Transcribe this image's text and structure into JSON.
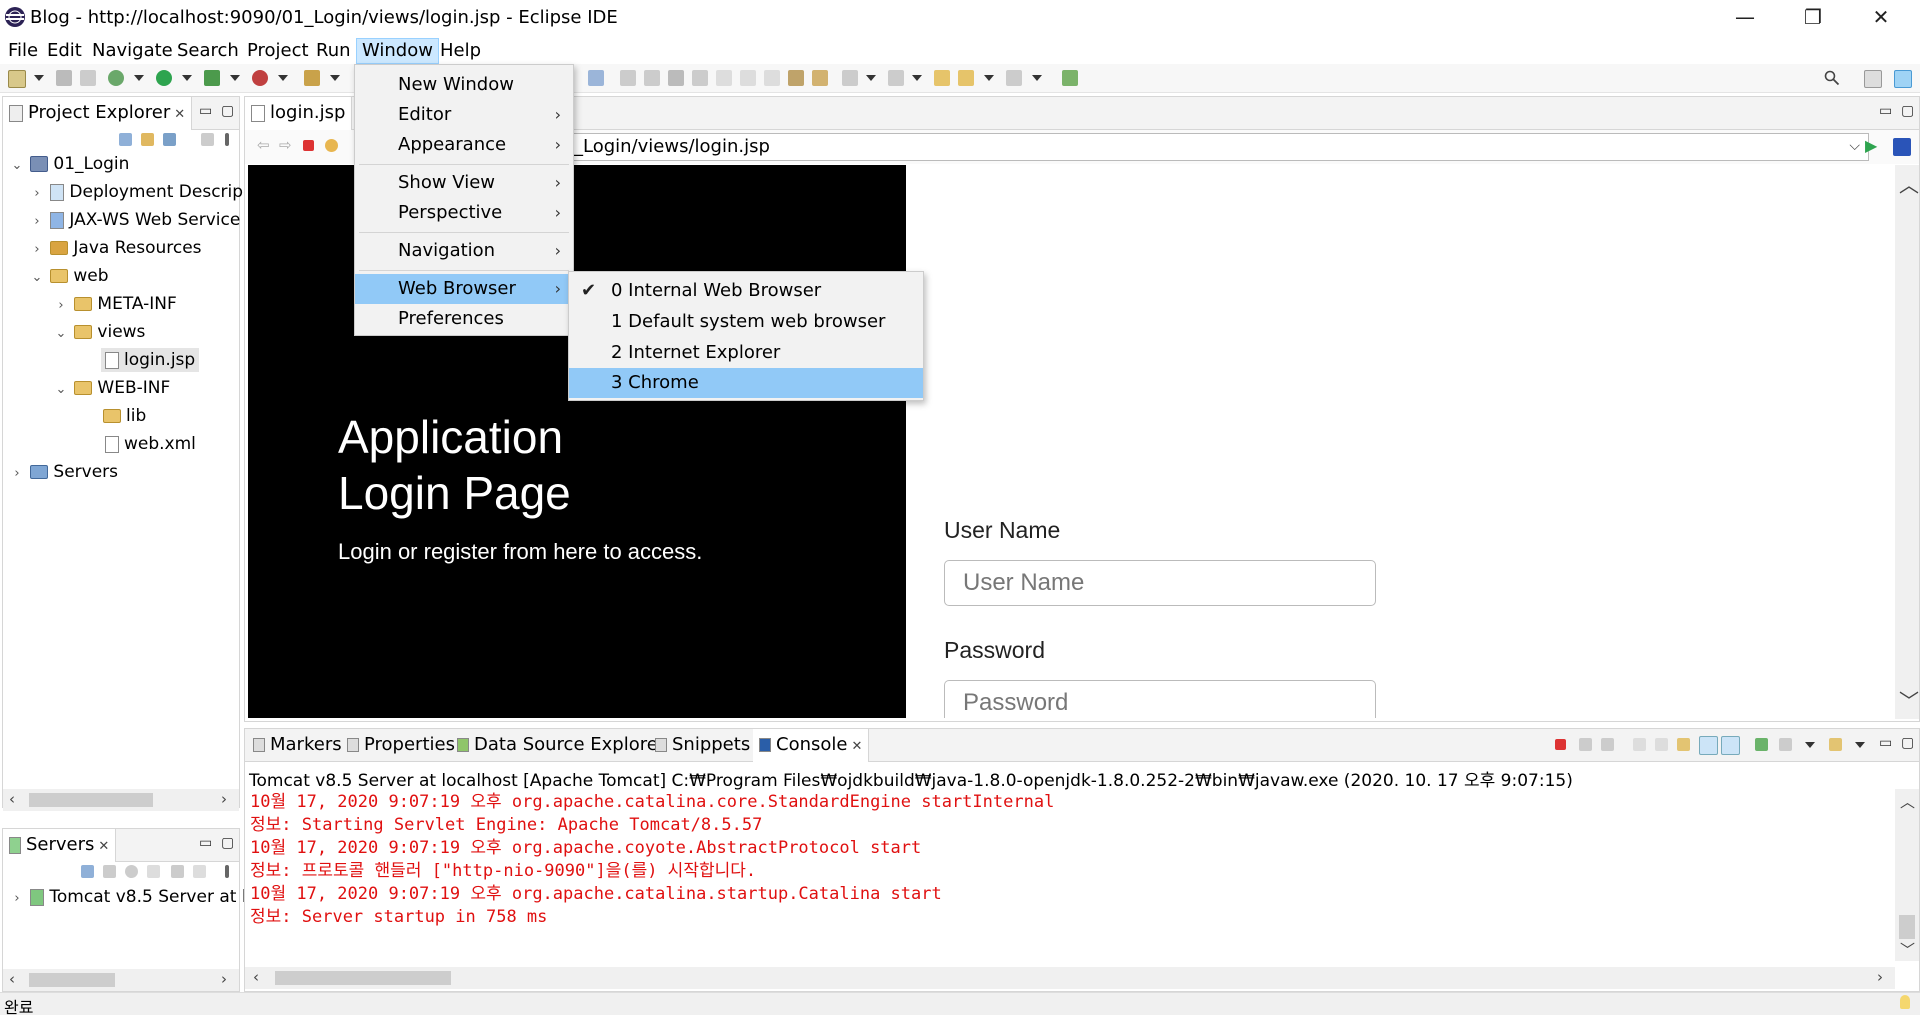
{
  "window": {
    "title": "Blog - http://localhost:9090/01_Login/views/login.jsp - Eclipse IDE",
    "minimize": "—",
    "restore": "❐",
    "close": "✕"
  },
  "menubar": {
    "items": [
      "File",
      "Edit",
      "Navigate",
      "Search",
      "Project",
      "Run",
      "Window",
      "Help"
    ]
  },
  "window_menu": {
    "items": [
      {
        "label": "New Window",
        "submenu": false
      },
      {
        "label": "Editor",
        "submenu": true
      },
      {
        "label": "Appearance",
        "submenu": true
      },
      {
        "label": "Show View",
        "submenu": true
      },
      {
        "label": "Perspective",
        "submenu": true
      },
      {
        "label": "Navigation",
        "submenu": true
      },
      {
        "label": "Web Browser",
        "submenu": true
      },
      {
        "label": "Preferences",
        "submenu": false
      }
    ],
    "submenu_arrow": "›"
  },
  "web_browser_submenu": {
    "check": "✔",
    "items": [
      "0 Internal Web Browser",
      "1 Default system web browser",
      "2 Internet Explorer",
      "3 Chrome"
    ]
  },
  "project_explorer": {
    "tab_label": "Project Explorer",
    "tree": [
      {
        "label": "01_Login",
        "twisty": "⌄",
        "icon": "project-icon"
      },
      {
        "label": "Deployment Descrip",
        "twisty": "›",
        "icon": "deployment-descriptor-icon"
      },
      {
        "label": "JAX-WS Web Service",
        "twisty": "›",
        "icon": "web-service-icon"
      },
      {
        "label": "Java Resources",
        "twisty": "›",
        "icon": "java-resources-icon"
      },
      {
        "label": "web",
        "twisty": "⌄",
        "icon": "folder-icon"
      },
      {
        "label": "META-INF",
        "twisty": "›",
        "icon": "folder-icon"
      },
      {
        "label": "views",
        "twisty": "⌄",
        "icon": "folder-icon"
      },
      {
        "label": "login.jsp",
        "twisty": "",
        "icon": "jsp-file-icon"
      },
      {
        "label": "WEB-INF",
        "twisty": "⌄",
        "icon": "folder-icon"
      },
      {
        "label": "lib",
        "twisty": "",
        "icon": "folder-icon"
      },
      {
        "label": "web.xml",
        "twisty": "",
        "icon": "xml-file-icon"
      },
      {
        "label": "Servers",
        "twisty": "›",
        "icon": "folder-icon"
      }
    ]
  },
  "servers_view": {
    "tab_label": "Servers",
    "row": "Tomcat v8.5 Server at l"
  },
  "editor": {
    "tab_label": "login.jsp",
    "url": "_Login/views/login.jsp"
  },
  "login_page": {
    "heading_line1": "Application",
    "heading_line2": "Login Page",
    "subtitle": "Login or register from here to access.",
    "username_label": "User Name",
    "username_placeholder": "User Name",
    "password_label": "Password",
    "password_placeholder": "Password"
  },
  "bottom_tabs": [
    "Markers",
    "Properties",
    "Data Source Explorer",
    "Snippets",
    "Console"
  ],
  "console": {
    "header": "Tomcat v8.5 Server at localhost [Apache Tomcat] C:₩Program Files₩ojdkbuild₩java-1.8.0-openjdk-1.8.0.252-2₩bin₩javaw.exe  (2020. 10. 17 오후 9:07:15)",
    "lines": [
      "10월 17, 2020 9:07:19 오후 org.apache.catalina.core.StandardEngine startInternal",
      "정보: Starting Servlet Engine: Apache Tomcat/8.5.57",
      "10월 17, 2020 9:07:19 오후 org.apache.coyote.AbstractProtocol start",
      "정보: 프로토콜 핸들러 [\"http-nio-9090\"]을(를) 시작합니다.",
      "10월 17, 2020 9:07:19 오후 org.apache.catalina.startup.Catalina start",
      "정보: Server startup in 758 ms"
    ],
    "color": "#e01010"
  },
  "statusbar": {
    "text": "완료"
  },
  "colors": {
    "menu_highlight": "#91c9f7",
    "active_menu": "#cce8ff",
    "browser_dark": "#000000"
  }
}
